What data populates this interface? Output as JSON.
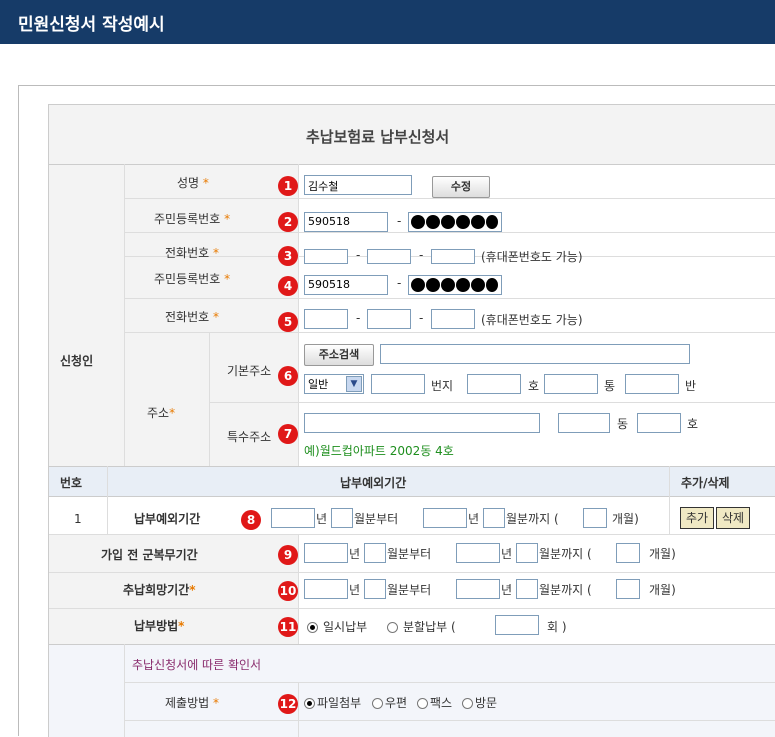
{
  "page": {
    "title": "민원신청서 작성예시"
  },
  "form": {
    "title": "추납보험료 납부신청서",
    "section_applicant": "신청인",
    "name_label": "성명",
    "name_value": "김수철",
    "edit_button": "수정",
    "rrn_label": "주민등록번호",
    "rrn_front": "590518",
    "dash": "-",
    "phone_label": "전화번호",
    "phone_hint": "(휴대폰번호도 가능)",
    "address_label": "주소",
    "basic_address_label": "기본주소",
    "address_search_button": "주소검색",
    "address_type_select": "일반",
    "unit_beonji": "번지",
    "unit_ho": "호",
    "unit_tong": "통",
    "unit_ban": "반",
    "special_address_label": "특수주소",
    "unit_dong": "동",
    "special_example": "예)월드컵아파트 2002동 4호",
    "required_mark": "*",
    "col_number": "번호",
    "col_exclusion_period": "납부예외기간",
    "col_add_delete": "추가/삭제",
    "row1_number": "1",
    "row1_label": "납부예외기간",
    "unit_year": "년",
    "unit_month_from": "월분부터",
    "unit_month_to": "월분까지 (",
    "unit_months": "개월)",
    "add_button": "추가",
    "delete_button": "삭제",
    "military_label": "가입 전 군복무기간",
    "desired_label": "추납희망기간",
    "payment_method_label": "납부방법",
    "payment_lump": "일시납부",
    "payment_installment": "분할납부 (",
    "unit_times": "회 )",
    "confirmation_text": "추납신청서에 따른 확인서",
    "submit_method_label": "제출방법",
    "submit_file": "파일첨부",
    "submit_post": "우편",
    "submit_fax": "팩스",
    "submit_visit": "방문"
  },
  "markers": [
    "1",
    "2",
    "3",
    "4",
    "5",
    "6",
    "7",
    "8",
    "9",
    "10",
    "11",
    "12"
  ],
  "colors": {
    "header_bg": "#163b68",
    "marker": "#e01818",
    "star": "#e87a00",
    "example_green": "#1f8f1f",
    "confirm_purple": "#8a2d6e"
  }
}
